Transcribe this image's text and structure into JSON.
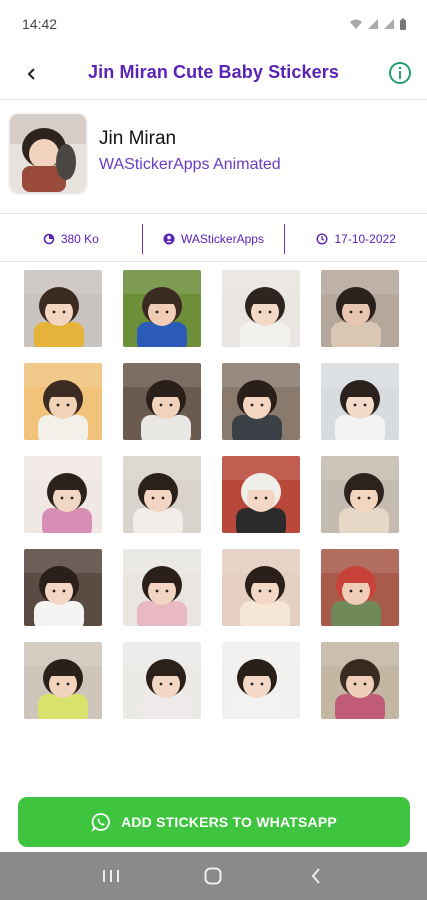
{
  "status_bar": {
    "time": "14:42",
    "icons": [
      "wifi-icon",
      "signal-icon",
      "signal-icon",
      "battery-icon"
    ]
  },
  "app_bar": {
    "title": "Jin Miran Cute Baby Stickers",
    "back_icon": "back-arrow-icon",
    "info_icon": "info-icon",
    "info_color": "#22a06b",
    "title_color": "#5a22b5"
  },
  "pack": {
    "name": "Jin Miran",
    "publisher": "WAStickerApps Animated"
  },
  "info_strip": {
    "size": "380 Ko",
    "author": "WAStickerApps",
    "date": "17-10-2022"
  },
  "stickers": {
    "count": 20,
    "items": [
      {
        "name": "sticker-1",
        "bg": "#c9c3bf",
        "hair": "#3a2a22",
        "shirt": "#e6b33a",
        "skin": "#f3d6c2"
      },
      {
        "name": "sticker-2",
        "bg": "#6d8f3a",
        "hair": "#3a2a22",
        "shirt": "#2a5bb8",
        "skin": "#f0cdb4"
      },
      {
        "name": "sticker-3",
        "bg": "#e9e5e0",
        "hair": "#2e2420",
        "shirt": "#f3f1ee",
        "skin": "#f4d9c6"
      },
      {
        "name": "sticker-4",
        "bg": "#b6a79c",
        "hair": "#2b201c",
        "shirt": "#d9c7b3",
        "skin": "#e9c6b0"
      },
      {
        "name": "sticker-5",
        "bg": "#f0c27a",
        "hair": "#3b2b22",
        "shirt": "#f2f0e8",
        "skin": "#f2d3b8"
      },
      {
        "name": "sticker-6",
        "bg": "#6b5a50",
        "hair": "#2b1f1a",
        "shirt": "#e9e7e4",
        "skin": "#f1d2bd"
      },
      {
        "name": "sticker-7",
        "bg": "#8a7a6e",
        "hair": "#2a1f19",
        "shirt": "#3b3f46",
        "skin": "#f3d5c2"
      },
      {
        "name": "sticker-8",
        "bg": "#d9dcdf",
        "hair": "#2b211c",
        "shirt": "#f4f4f4",
        "skin": "#f4dac9"
      },
      {
        "name": "sticker-9",
        "bg": "#efe8e4",
        "hair": "#2c211b",
        "shirt": "#d98fb5",
        "skin": "#f2d6c4"
      },
      {
        "name": "sticker-10",
        "bg": "#d8d3cc",
        "hair": "#2c201a",
        "shirt": "#f2ede8",
        "skin": "#f2d5c3"
      },
      {
        "name": "sticker-11",
        "bg": "#b9483a",
        "hair": "#f0eee9",
        "shirt": "#2b2b2b",
        "skin": "#f3d6c4"
      },
      {
        "name": "sticker-12",
        "bg": "#c6bbb0",
        "hair": "#2d221c",
        "shirt": "#e7d7c7",
        "skin": "#f3d5c0"
      },
      {
        "name": "sticker-13",
        "bg": "#5a4b43",
        "hair": "#2a1f19",
        "shirt": "#f4f4f2",
        "skin": "#f3d6c4"
      },
      {
        "name": "sticker-14",
        "bg": "#e9e6e2",
        "hair": "#2b2019",
        "shirt": "#e8b9c3",
        "skin": "#f2d5c3"
      },
      {
        "name": "sticker-15",
        "bg": "#e4cfc0",
        "hair": "#2a1f19",
        "shirt": "#f5e6d6",
        "skin": "#f3d8c6"
      },
      {
        "name": "sticker-16",
        "bg": "#a85b4a",
        "hair": "#c9423a",
        "shirt": "#6f8a58",
        "skin": "#f0cdb8"
      },
      {
        "name": "sticker-17",
        "bg": "#d0c5ba",
        "hair": "#2b2019",
        "shirt": "#d9e36b",
        "skin": "#f2d3bd"
      },
      {
        "name": "sticker-18",
        "bg": "#eceae7",
        "hair": "#2b201a",
        "shirt": "#efe9ea",
        "skin": "#f3d7c5"
      },
      {
        "name": "sticker-19",
        "bg": "#f1f0ee",
        "hair": "#2b2019",
        "shirt": "#f2f2f2",
        "skin": "#f3d8c7"
      },
      {
        "name": "sticker-20",
        "bg": "#c3b7a4",
        "hair": "#3a2b22",
        "shirt": "#c25a7a",
        "skin": "#efcfb9"
      }
    ]
  },
  "add_button": {
    "label": "ADD STICKERS TO WHATSAPP",
    "icon": "whatsapp-icon",
    "color": "#3ec43e"
  },
  "nav_bar": {
    "buttons": [
      "recent-apps-icon",
      "home-icon",
      "back-icon"
    ]
  }
}
